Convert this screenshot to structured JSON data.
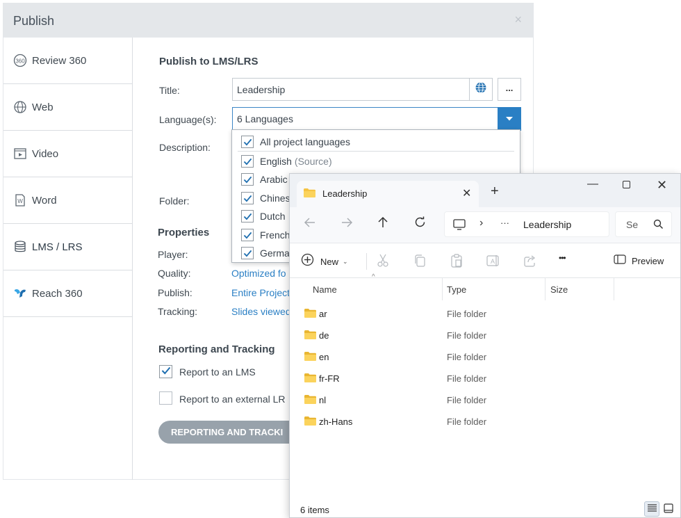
{
  "publish_dialog": {
    "title": "Publish",
    "close_glyph": "×",
    "sidebar": [
      {
        "label": "Review 360",
        "icon": "review-360-icon"
      },
      {
        "label": "Web",
        "icon": "globe-icon"
      },
      {
        "label": "Video",
        "icon": "video-icon"
      },
      {
        "label": "Word",
        "icon": "word-document-icon"
      },
      {
        "label": "LMS / LRS",
        "icon": "database-icon",
        "active": true
      },
      {
        "label": "Reach 360",
        "icon": "reach-360-icon"
      }
    ],
    "section_title": "Publish to LMS/LRS",
    "title_label": "Title:",
    "title_value": "Leadership",
    "more_button": "...",
    "languages_label": "Language(s):",
    "languages_value": "6 Languages",
    "description_label": "Description:",
    "folder_label": "Folder:",
    "language_options": [
      {
        "label": "All project languages",
        "checked": true
      },
      {
        "label": "English",
        "suffix": "(Source)",
        "checked": true
      },
      {
        "label": "Arabic",
        "checked": true
      },
      {
        "label": "Chines",
        "checked": true
      },
      {
        "label": "Dutch",
        "checked": true
      },
      {
        "label": "French",
        "checked": true
      },
      {
        "label": "Germa",
        "checked": true
      }
    ],
    "properties": {
      "title": "Properties",
      "rows": [
        {
          "label": "Player:",
          "value": ""
        },
        {
          "label": "Quality:",
          "value": "Optimized fo"
        },
        {
          "label": "Publish:",
          "value": "Entire Project"
        },
        {
          "label": "Tracking:",
          "value": "Slides viewed"
        }
      ]
    },
    "reporting": {
      "title": "Reporting and Tracking",
      "option_lms": "Report to an LMS",
      "option_lms_checked": true,
      "option_lrs": "Report to an external LR",
      "option_lrs_checked": false,
      "button": "REPORTING AND TRACKI"
    },
    "colors": {
      "accent": "#2a7fc4",
      "header_bg": "#e4e7ea",
      "button_bg": "#98a2ab"
    }
  },
  "explorer": {
    "tab_title": "Leadership",
    "new_tab_glyph": "+",
    "address_crumb": "Leadership",
    "ellipsis": "···",
    "search_placeholder": "Se",
    "toolbar": {
      "new_label": "New",
      "more_glyph": "•••",
      "preview_label": "Preview"
    },
    "columns": [
      "Name",
      "Type",
      "Size"
    ],
    "rows": [
      {
        "name": "ar",
        "type": "File folder"
      },
      {
        "name": "de",
        "type": "File folder"
      },
      {
        "name": "en",
        "type": "File folder"
      },
      {
        "name": "fr-FR",
        "type": "File folder"
      },
      {
        "name": "nl",
        "type": "File folder"
      },
      {
        "name": "zh-Hans",
        "type": "File folder"
      }
    ],
    "status": "6 items"
  }
}
